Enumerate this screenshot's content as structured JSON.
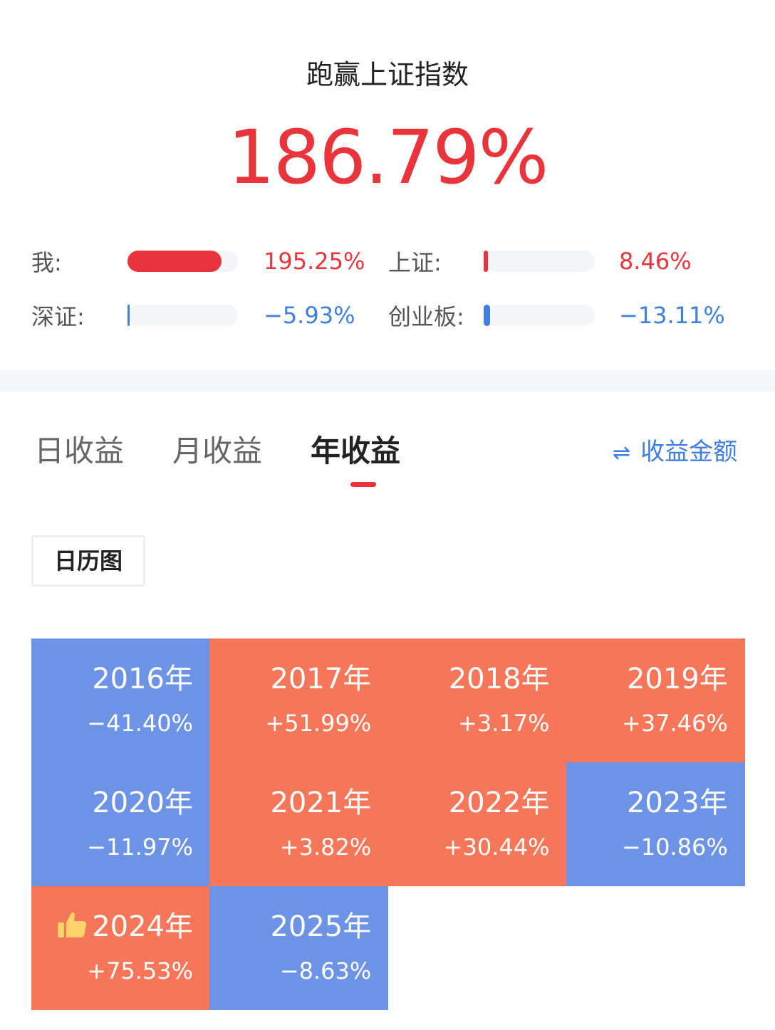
{
  "header": {
    "title": "跑赢上证指数",
    "outperform_value": "186.79%"
  },
  "comparisons": [
    {
      "label": "我:",
      "value": "195.25%",
      "fill_fraction": 0.85,
      "color": "#e8343a"
    },
    {
      "label": "上证:",
      "value": "8.46%",
      "fill_fraction": 0.04,
      "color": "#e8343a"
    },
    {
      "label": "深证:",
      "value": "−5.93%",
      "fill_fraction": 0.02,
      "color": "#3f7fe0"
    },
    {
      "label": "创业板:",
      "value": "−13.11%",
      "fill_fraction": 0.06,
      "color": "#3f7fe0"
    }
  ],
  "tabs": [
    {
      "label": "日收益",
      "active": false
    },
    {
      "label": "月收益",
      "active": false
    },
    {
      "label": "年收益",
      "active": true
    }
  ],
  "switch_label": "收益金额",
  "switch_icon": "swap-arrows-icon",
  "calendar_button": "日历图",
  "colors": {
    "positive": "#f6765a",
    "negative": "#6d93e6",
    "accent_red": "#e8343a",
    "accent_blue": "#3f7fe0"
  },
  "years": [
    {
      "year": "2016年",
      "return": "−41.40%",
      "sign": "negative"
    },
    {
      "year": "2017年",
      "return": "+51.99%",
      "sign": "positive"
    },
    {
      "year": "2018年",
      "return": "+3.17%",
      "sign": "positive"
    },
    {
      "year": "2019年",
      "return": "+37.46%",
      "sign": "positive"
    },
    {
      "year": "2020年",
      "return": "−11.97%",
      "sign": "negative"
    },
    {
      "year": "2021年",
      "return": "+3.82%",
      "sign": "positive"
    },
    {
      "year": "2022年",
      "return": "+30.44%",
      "sign": "positive"
    },
    {
      "year": "2023年",
      "return": "−10.86%",
      "sign": "negative"
    },
    {
      "year": "2024年",
      "return": "+75.53%",
      "sign": "positive",
      "icon": "thumbs-up-icon"
    },
    {
      "year": "2025年",
      "return": "−8.63%",
      "sign": "negative"
    }
  ]
}
